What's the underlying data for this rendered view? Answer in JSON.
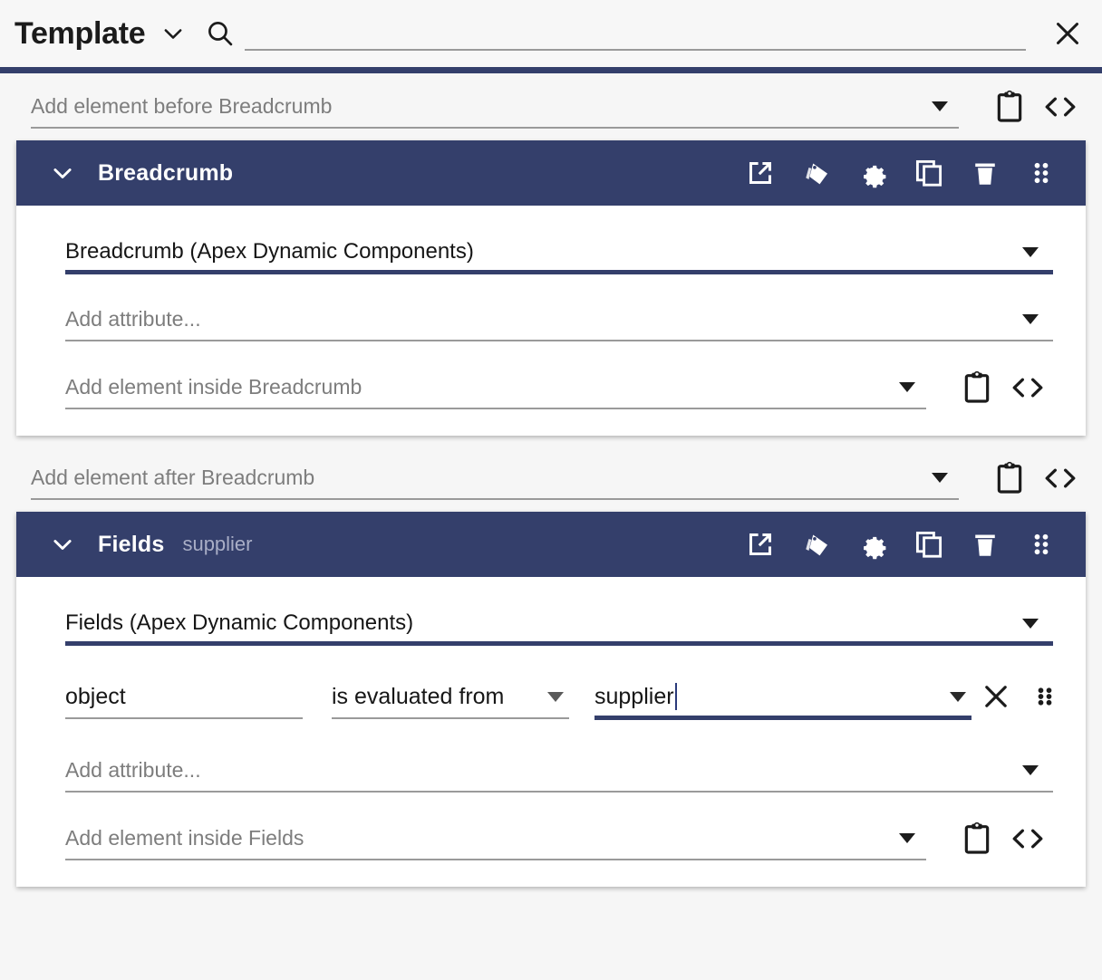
{
  "header": {
    "title": "Template",
    "title_caret_icon": "chevron-down-icon",
    "search_icon": "search-icon",
    "search_value": "",
    "search_placeholder": "",
    "close_icon": "close-icon",
    "accent_color": "#343f6b"
  },
  "rows": {
    "before_breadcrumb": {
      "placeholder": "Add element before Breadcrumb",
      "paste_icon": "clipboard-paste-icon",
      "code_icon": "code-brackets-icon"
    },
    "after_breadcrumb": {
      "placeholder": "Add element after Breadcrumb",
      "paste_icon": "clipboard-paste-icon",
      "code_icon": "code-brackets-icon"
    }
  },
  "breadcrumb_card": {
    "collapse_icon": "chevron-down-icon",
    "title": "Breadcrumb",
    "subtitle": "",
    "header_icons": [
      {
        "name": "open-in-new-icon",
        "label": "Open in new"
      },
      {
        "name": "style-palette-icon",
        "label": "Style"
      },
      {
        "name": "gear-icon",
        "label": "Settings"
      },
      {
        "name": "copy-icon",
        "label": "Copy"
      },
      {
        "name": "trash-icon",
        "label": "Delete"
      },
      {
        "name": "drag-handle-icon",
        "label": "Drag"
      }
    ],
    "component_select": {
      "value": "Breadcrumb (Apex Dynamic Components)",
      "focused": true
    },
    "add_attribute": {
      "placeholder": "Add attribute..."
    },
    "add_inside": {
      "placeholder": "Add element inside Breadcrumb",
      "paste_icon": "clipboard-paste-icon",
      "code_icon": "code-brackets-icon"
    }
  },
  "fields_card": {
    "collapse_icon": "chevron-down-icon",
    "title": "Fields",
    "subtitle": "supplier",
    "header_icons": [
      {
        "name": "open-in-new-icon",
        "label": "Open in new"
      },
      {
        "name": "style-palette-icon",
        "label": "Style"
      },
      {
        "name": "gear-icon",
        "label": "Settings"
      },
      {
        "name": "copy-icon",
        "label": "Copy"
      },
      {
        "name": "trash-icon",
        "label": "Delete"
      },
      {
        "name": "drag-handle-icon",
        "label": "Drag"
      }
    ],
    "component_select": {
      "value": "Fields (Apex Dynamic Components)",
      "focused": true
    },
    "attribute": {
      "name": "object",
      "operator": "is evaluated from",
      "value": "supplier",
      "value_focused": true,
      "remove_icon": "close-icon",
      "drag_icon": "drag-handle-icon"
    },
    "add_attribute": {
      "placeholder": "Add attribute..."
    },
    "add_inside": {
      "placeholder": "Add element inside Fields",
      "paste_icon": "clipboard-paste-icon",
      "code_icon": "code-brackets-icon"
    }
  }
}
